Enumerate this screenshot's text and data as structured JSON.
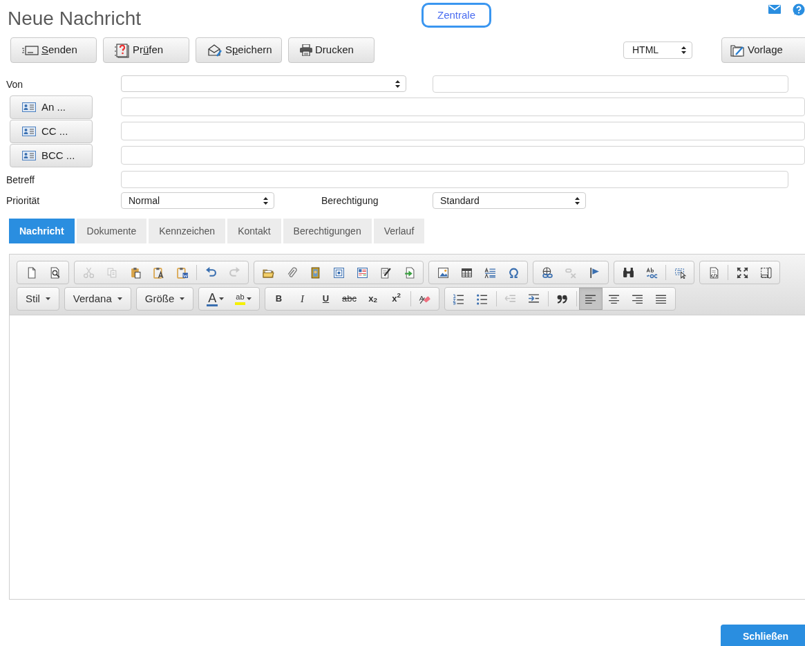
{
  "title": "Neue Nachricht",
  "context_button": "Zentrale",
  "actions": [
    {
      "mnemonic": "S",
      "after": "enden"
    },
    {
      "before": "Pr",
      "mnemonic": "ü",
      "after": "fen"
    },
    {
      "before": "S",
      "mnemonic": "p",
      "after": "eichern"
    },
    {
      "before": "Drucken"
    }
  ],
  "format_select": "HTML",
  "template_button": "Vorlage",
  "form": {
    "from_label": "Von",
    "recipients": [
      {
        "label": "An ..."
      },
      {
        "label": "CC ..."
      },
      {
        "label": "BCC ..."
      }
    ],
    "subject_label": "Betreff",
    "priority_label": "Priorität",
    "priority_value": "Normal",
    "permission_label": "Berechtigung",
    "permission_value": "Standard"
  },
  "tabs": [
    {
      "label": "Nachricht",
      "selected": true
    },
    {
      "label": "Dokumente",
      "selected": false
    },
    {
      "label": "Kennzeichen",
      "selected": false
    },
    {
      "label": "Kontakt",
      "selected": false
    },
    {
      "label": "Berechtigungen",
      "selected": false
    },
    {
      "label": "Verlauf",
      "selected": false
    }
  ],
  "editor": {
    "toolbar_rows": [
      [
        [
          {
            "kind": "icon",
            "disabled": false
          },
          {
            "kind": "icon",
            "disabled": false
          }
        ],
        [
          {
            "kind": "icon",
            "disabled": true
          },
          {
            "kind": "icon",
            "disabled": true
          },
          {
            "kind": "icon",
            "disabled": false
          },
          {
            "kind": "icon",
            "disabled": false
          },
          {
            "kind": "icon",
            "disabled": false
          },
          {
            "kind": "separator"
          },
          {
            "kind": "icon",
            "disabled": false
          },
          {
            "kind": "icon",
            "disabled": true
          }
        ],
        [
          {
            "kind": "icon",
            "disabled": false
          },
          {
            "kind": "icon",
            "disabled": false
          },
          {
            "kind": "icon",
            "disabled": false
          },
          {
            "kind": "icon",
            "disabled": false
          },
          {
            "kind": "icon",
            "disabled": false
          },
          {
            "kind": "icon",
            "disabled": false
          },
          {
            "kind": "icon",
            "disabled": false
          }
        ],
        [
          {
            "kind": "icon",
            "disabled": false
          },
          {
            "kind": "icon",
            "disabled": false
          },
          {
            "kind": "icon",
            "disabled": false
          },
          {
            "kind": "icon",
            "disabled": false
          }
        ],
        [
          {
            "kind": "icon",
            "disabled": false
          },
          {
            "kind": "icon",
            "disabled": true
          },
          {
            "kind": "icon",
            "disabled": false
          }
        ],
        [
          {
            "kind": "icon",
            "disabled": false
          },
          {
            "kind": "icon",
            "disabled": false
          },
          {
            "kind": "separator"
          },
          {
            "kind": "icon",
            "disabled": false
          }
        ],
        [
          {
            "kind": "icon",
            "disabled": false
          },
          {
            "kind": "separator"
          },
          {
            "kind": "icon",
            "disabled": false
          },
          {
            "kind": "icon",
            "disabled": false
          }
        ]
      ],
      [
        [
          {
            "kind": "dropdown",
            "label": "Stil"
          }
        ],
        [
          {
            "kind": "dropdown",
            "label": "Verdana"
          }
        ],
        [
          {
            "kind": "dropdown",
            "label": "Größe"
          }
        ],
        [
          {
            "kind": "text-color",
            "label": "A"
          },
          {
            "kind": "highlight",
            "label": "ab"
          }
        ],
        [
          {
            "kind": "bold",
            "label": "B"
          },
          {
            "kind": "italic",
            "label": "I"
          },
          {
            "kind": "underline",
            "label": "U"
          },
          {
            "kind": "strike",
            "label": "abc"
          },
          {
            "kind": "format",
            "label": "x$_{2}$"
          },
          {
            "kind": "format",
            "label": "x$^{2}$"
          },
          {
            "kind": "separator"
          },
          {
            "kind": "icon",
            "disabled": false
          }
        ],
        [
          {
            "kind": "icon",
            "disabled": false
          },
          {
            "kind": "icon",
            "disabled": false
          },
          {
            "kind": "separator"
          },
          {
            "kind": "icon",
            "disabled": true
          },
          {
            "kind": "icon",
            "disabled": false
          },
          {
            "kind": "separator"
          },
          {
            "kind": "icon",
            "disabled": false
          },
          {
            "kind": "separator"
          },
          {
            "kind": "icon",
            "disabled": false,
            "selected": true
          },
          {
            "kind": "icon",
            "disabled": false,
            "selected": false
          },
          {
            "kind": "icon",
            "disabled": false,
            "selected": false
          },
          {
            "kind": "icon",
            "disabled": false,
            "selected": false
          }
        ]
      ]
    ]
  },
  "close_button": "Schließen"
}
